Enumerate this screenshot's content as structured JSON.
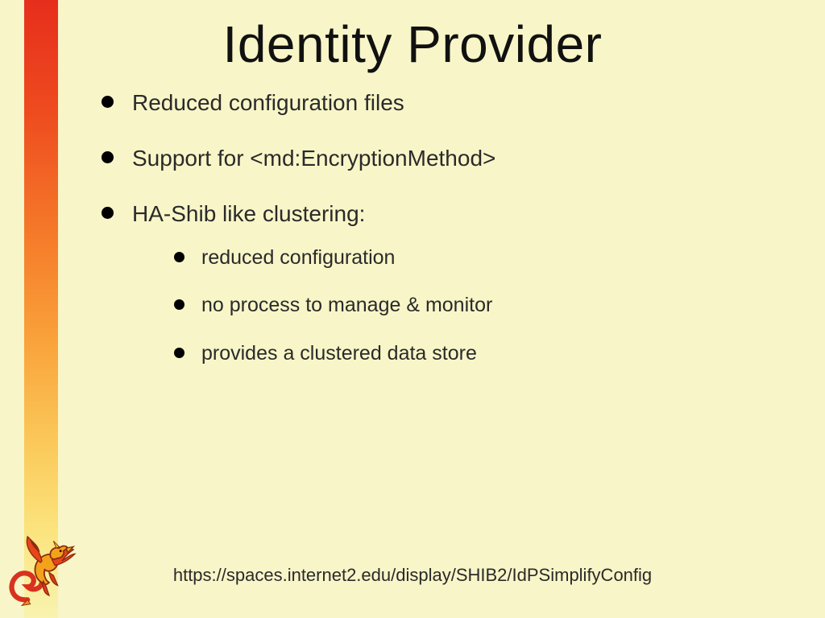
{
  "title": "Identity Provider",
  "bullets": {
    "b1": "Reduced configuration files",
    "b2": "Support for <md:EncryptionMethod>",
    "b3": "HA-Shib like clustering:",
    "sub": {
      "s1": "reduced configuration",
      "s2": "no process to manage & monitor",
      "s3": "provides a clustered data store"
    }
  },
  "footer_url": "https://spaces.internet2.edu/display/SHIB2/IdPSimplifyConfig"
}
